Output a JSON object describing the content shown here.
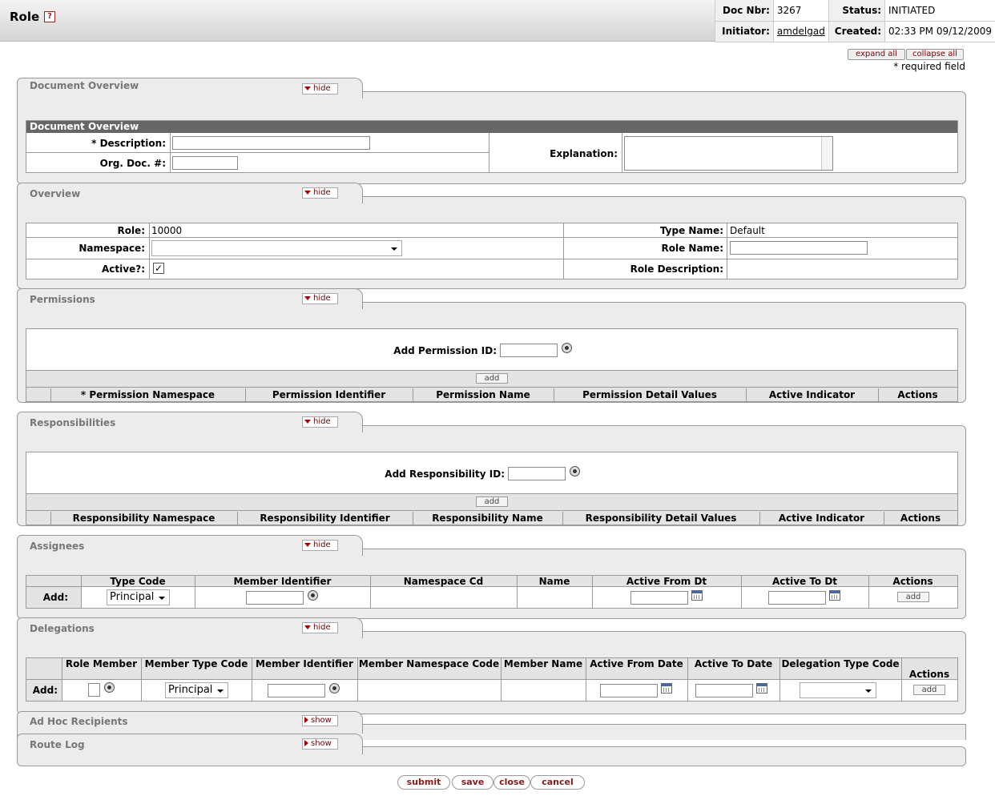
{
  "header": {
    "title": "Role",
    "help": "?",
    "doc_nbr_label": "Doc Nbr:",
    "doc_nbr": "3267",
    "status_label": "Status:",
    "status": "INITIATED",
    "initiator_label": "Initiator:",
    "initiator": "amdelgad",
    "created_label": "Created:",
    "created": "02:33 PM 09/12/2009"
  },
  "global": {
    "expand_all": "expand all",
    "collapse_all": "collapse all",
    "required_note": "* required field",
    "hide": "hide",
    "show": "show",
    "add": "add"
  },
  "doc_overview": {
    "tab": "Document Overview",
    "section": "Document Overview",
    "description_label": "* Description:",
    "orgdoc_label": "Org. Doc. #:",
    "explanation_label": "Explanation:"
  },
  "overview": {
    "tab": "Overview",
    "role_label": "Role:",
    "role_value": "10000",
    "namespace_label": "Namespace:",
    "active_label": "Active?:",
    "active_check": "✓",
    "type_name_label": "Type Name:",
    "type_name_value": "Default",
    "role_name_label": "Role Name:",
    "role_desc_label": "Role Description:"
  },
  "permissions": {
    "tab": "Permissions",
    "add_label": "Add Permission ID:",
    "columns": [
      "* Permission Namespace",
      "Permission Identifier",
      "Permission Name",
      "Permission Detail Values",
      "Active Indicator",
      "Actions"
    ]
  },
  "responsibilities": {
    "tab": "Responsibilities",
    "add_label": "Add Responsibility ID:",
    "columns": [
      "Responsibility Namespace",
      "Responsibility Identifier",
      "Responsibility Name",
      "Responsibility Detail Values",
      "Active Indicator",
      "Actions"
    ]
  },
  "assignees": {
    "tab": "Assignees",
    "columns": [
      "Type Code",
      "Member Identifier",
      "Namespace Cd",
      "Name",
      "Active From Dt",
      "Active To Dt",
      "Actions"
    ],
    "add_label": "Add:",
    "type_code": "Principal"
  },
  "delegations": {
    "tab": "Delegations",
    "columns": [
      "Role Member",
      "Member Type Code",
      "Member Identifier",
      "Member Namespace Code",
      "Member Name",
      "Active From Date",
      "Active To Date",
      "Delegation Type Code",
      "Actions"
    ],
    "add_label": "Add:",
    "member_type": "Principal"
  },
  "adhoc": {
    "tab": "Ad Hoc Recipients"
  },
  "routelog": {
    "tab": "Route Log"
  },
  "buttons": {
    "submit": "submit",
    "save": "save",
    "close": "close",
    "cancel": "cancel"
  }
}
